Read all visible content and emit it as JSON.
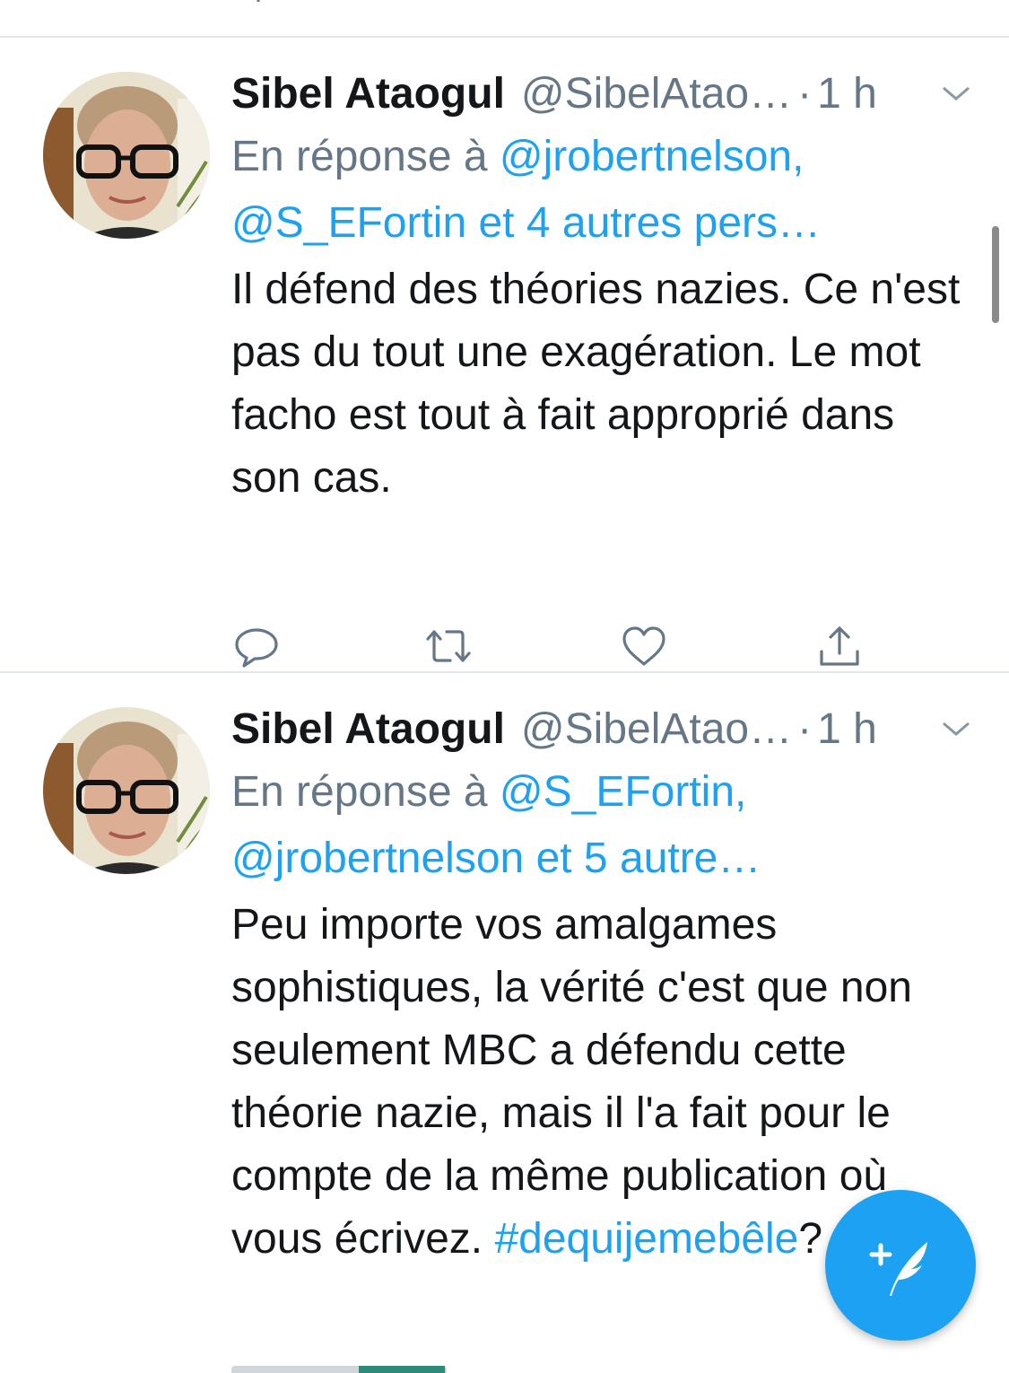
{
  "colors": {
    "link": "#1da1f2",
    "secondary_text": "#657786",
    "primary_text": "#14171a",
    "divider": "#e1e8ed",
    "fab_background": "#1da1f2"
  },
  "tweets": [
    {
      "name": "Sibel Ataogul",
      "handle": "@SibelAtao…",
      "separator": "·",
      "time": "1 h",
      "reply_prefix": "En réponse à",
      "reply_mentions_line1": "@jrobertnelson,",
      "reply_mentions_line2": "@S_EFortin et 4 autres pers…",
      "text": "Il défend des théories nazies. Ce n'est pas du tout une exagération. Le mot facho est tout à fait approprié dans son cas."
    },
    {
      "name": "Sibel Ataogul",
      "handle": "@SibelAtao…",
      "separator": "·",
      "time": "1 h",
      "reply_prefix": "En réponse à",
      "reply_mentions_line1": "@S_EFortin,",
      "reply_mentions_line2": "@jrobertnelson et 5 autre…",
      "text": "Peu importe vos amalgames sophistiques, la vérité c'est que non seulement MBC a défendu cette théorie nazie, mais il l'a fait pour le compte de la même publication où vous écrivez. ",
      "hashtag": "#dequijemebêle",
      "text_end": "?"
    }
  ],
  "icons": {
    "reply": "reply-icon",
    "retweet": "retweet-icon",
    "like": "heart-icon",
    "share": "share-icon",
    "caret": "chevron-down-icon",
    "compose": "compose-tweet-icon"
  }
}
